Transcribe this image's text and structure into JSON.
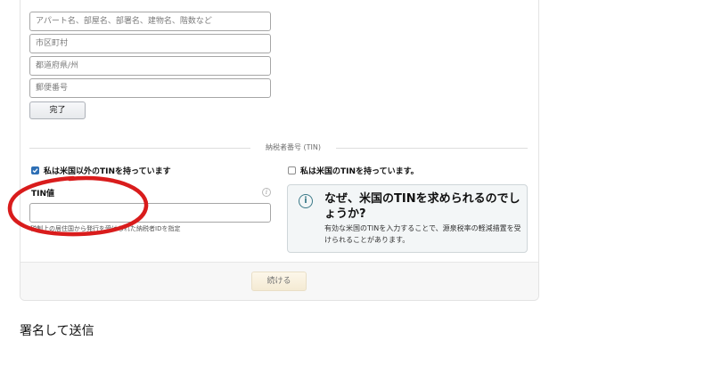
{
  "address_form": {
    "address_line2_placeholder": "アパート名、部屋名、部署名、建物名、階数など",
    "city_placeholder": "市区町村",
    "state_placeholder": "都道府県/州",
    "postal_code_placeholder": "郵便番号",
    "done_button": "完了"
  },
  "tin_section": {
    "divider_label": "納税者番号 (TIN)",
    "non_us_tin_checkbox": {
      "label": "私は米国以外のTINを持っています",
      "checked": true
    },
    "us_tin_checkbox": {
      "label": "私は米国のTINを持っています。",
      "checked": false
    },
    "tin_value_label": "TIN値",
    "tin_value_input": "",
    "tin_hint": "税制上の居住国から発行を受けられた納税者IDを指定",
    "info_box": {
      "title": "なぜ、米国のTINを求められるのでしょうか?",
      "body": "有効な米国のTINを入力することで、源泉税率の軽減措置を受けられることがあります。"
    }
  },
  "footer": {
    "continue_button": "続ける"
  },
  "next_section": {
    "heading": "署名して送信"
  },
  "colors": {
    "annotation_circle": "#d91c1c",
    "checkbox_checked": "#2e6fb5",
    "info_accent": "#3b7a88"
  },
  "icons": {
    "info_small": "info-icon",
    "info_box": "info-circle-icon",
    "check": "checkmark-icon"
  }
}
